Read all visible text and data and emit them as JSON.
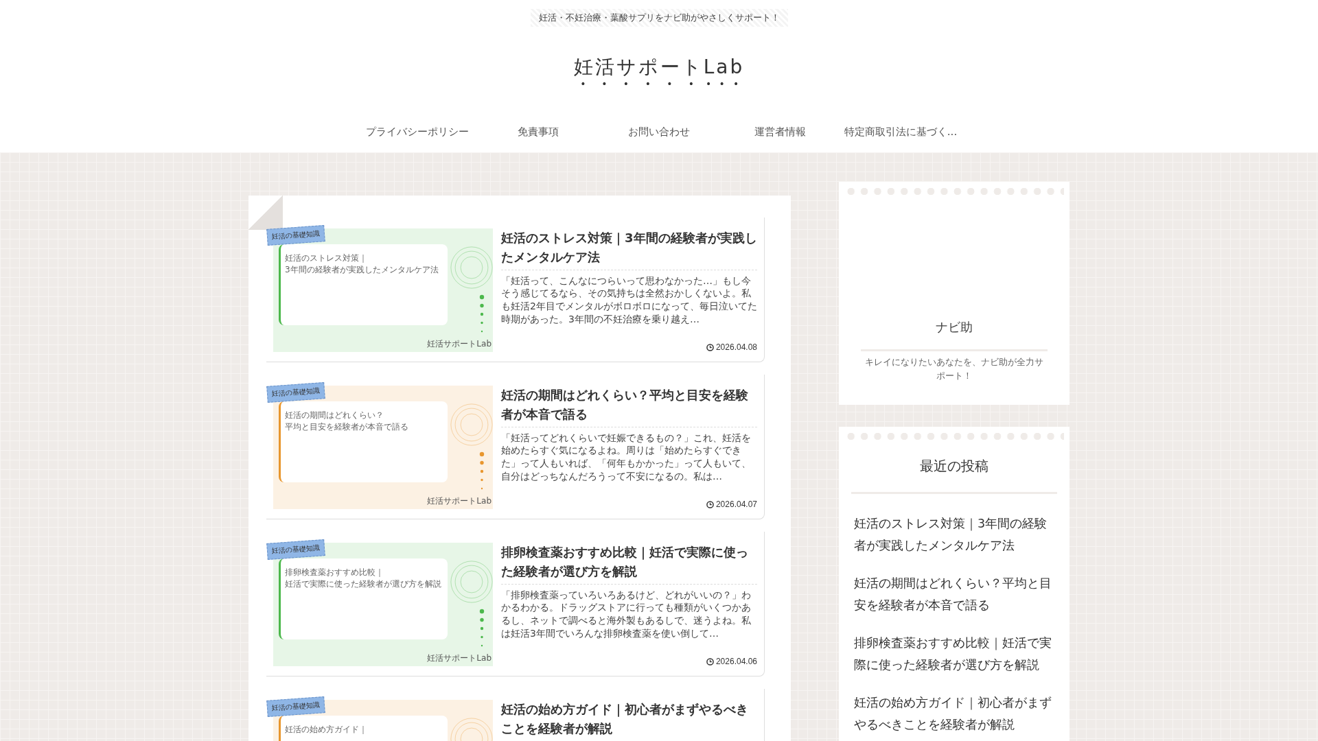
{
  "header": {
    "tagline": "妊活・不妊治療・葉酸サプリをナビ助がやさしくサポート！",
    "site_title": "妊活サポートLab"
  },
  "nav": {
    "items": [
      "プライバシーポリシー",
      "免責事項",
      "お問い合わせ",
      "運営者情報",
      "特定商取引法に基づく..."
    ]
  },
  "posts": [
    {
      "title": "妊活のストレス対策｜3年間の経験者が実践したメンタルケア法",
      "excerpt": "「妊活って、こんなにつらいって思わなかった…」もし今そう感じてるなら、その気持ちは全然おかしくないよ。私も妊活2年目でメンタルがボロボロになって、毎日泣いてた時期があった。3年間の不妊治療を乗り越え…",
      "date": "2026.04.08",
      "thumb": {
        "color": "#4cb84c",
        "tag": "妊活の基礎知識",
        "lines": [
          "妊活のストレス対策｜",
          "3年間の経験者が実践したメンタルケア法"
        ],
        "footer": "妊活サポートLab"
      }
    },
    {
      "title": "妊活の期間はどれくらい？平均と目安を経験者が本音で語る",
      "excerpt": "「妊活ってどれくらいで妊娠できるもの？」これ、妊活を始めたらすぐ気になるよね。周りは「始めたらすぐできた」って人もいれば、「何年もかかった」って人もいて、自分はどっちなんだろうって不安になるの。私は…",
      "date": "2026.04.07",
      "thumb": {
        "color": "#e8962e",
        "tag": "妊活の基礎知識",
        "lines": [
          "妊活の期間はどれくらい？",
          "平均と目安を経験者が本音で語る"
        ],
        "footer": "妊活サポートLab"
      }
    },
    {
      "title": "排卵検査薬おすすめ比較｜妊活で実際に使った経験者が選び方を解説",
      "excerpt": "「排卵検査薬っていろいろあるけど、どれがいいの？」わかるわかる。ドラッグストアに行っても種類がいくつかあるし、ネットで調べると海外製もあるしで、迷うよね。私は妊活3年間でいろんな排卵検査薬を使い倒して…",
      "date": "2026.04.06",
      "thumb": {
        "color": "#4cb84c",
        "tag": "妊活の基礎知識",
        "lines": [
          "排卵検査薬おすすめ比較｜",
          "妊活で実際に使った経験者が選び方を解説"
        ],
        "footer": "妊活サポートLab"
      }
    },
    {
      "title": "妊活の始め方ガイド｜初心者がまずやるべきことを経験者が解説",
      "thumb": {
        "color": "#e8962e",
        "tag": "妊活の基礎知識",
        "lines": [
          "妊活の始め方ガイド｜"
        ]
      }
    }
  ],
  "profile": {
    "name": "ナビ助",
    "bio": "キレイになりたいあなたを、ナビ助が全力サポート！"
  },
  "recent": {
    "heading": "最近の投稿",
    "items": [
      "妊活のストレス対策｜3年間の経験者が実践したメンタルケア法",
      "妊活の期間はどれくらい？平均と目安を経験者が本音で語る",
      "排卵検査薬おすすめ比較｜妊活で実際に使った経験者が選び方を解説",
      "妊活の始め方ガイド｜初心者がまずやるべきことを経験者が解説"
    ]
  }
}
